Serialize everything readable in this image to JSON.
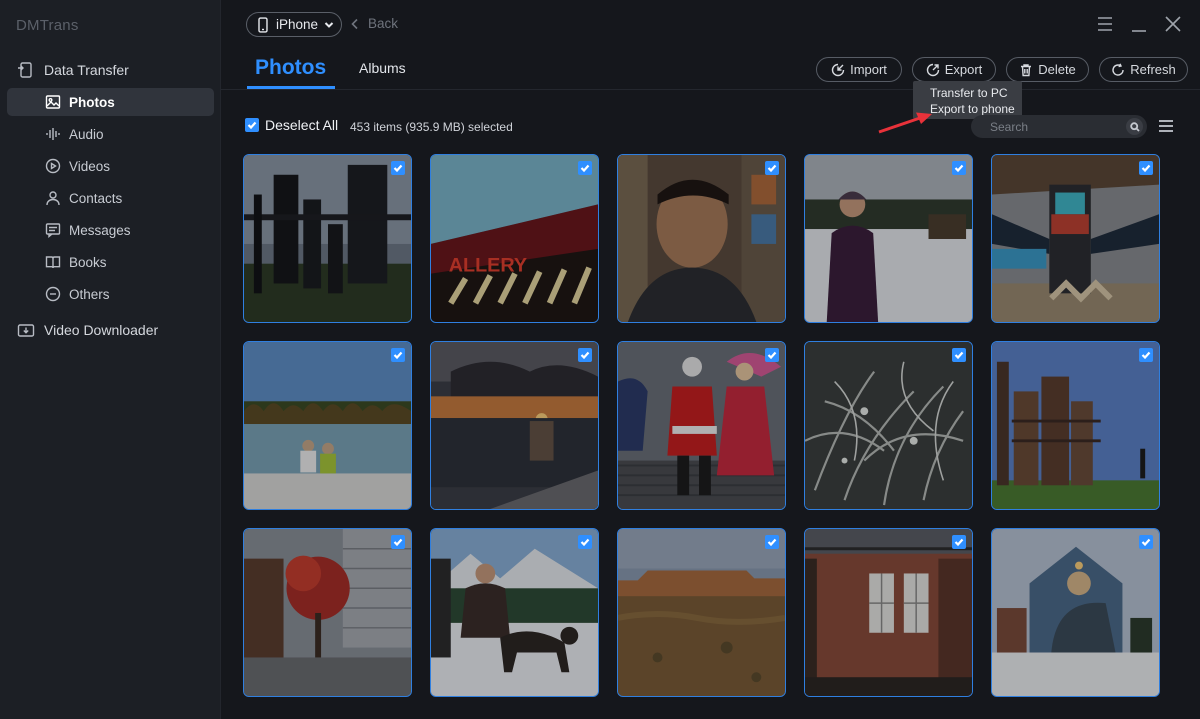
{
  "app": {
    "name": "DMTrans"
  },
  "sidebar": {
    "data_transfer": "Data Transfer",
    "items": [
      {
        "label": "Photos",
        "icon": "photos-icon",
        "active": true
      },
      {
        "label": "Audio",
        "icon": "audio-icon"
      },
      {
        "label": "Videos",
        "icon": "videos-icon"
      },
      {
        "label": "Contacts",
        "icon": "contacts-icon"
      },
      {
        "label": "Messages",
        "icon": "messages-icon"
      },
      {
        "label": "Books",
        "icon": "books-icon"
      },
      {
        "label": "Others",
        "icon": "others-icon"
      }
    ],
    "video_downloader": "Video Downloader"
  },
  "topbar": {
    "device": "iPhone",
    "back": "Back"
  },
  "tabs": {
    "photos": "Photos",
    "albums": "Albums"
  },
  "toolbar": {
    "import": "Import",
    "export": "Export",
    "delete": "Delete",
    "refresh": "Refresh"
  },
  "export_menu": {
    "transfer_to_pc": "Transfer to PC",
    "export_to_phone": "Export to phone"
  },
  "selection": {
    "deselect_all": "Deselect All",
    "info": "453 items (935.9 MB) selected"
  },
  "search": {
    "placeholder": "Search"
  },
  "colors": {
    "accent": "#2f8fff",
    "arrow": "#e8323a",
    "background": "#15171c",
    "sidebar": "#1c1f25"
  },
  "photos": [
    {
      "subject": "industrial-silhouette",
      "selected": true
    },
    {
      "subject": "gallery-sign",
      "selected": true
    },
    {
      "subject": "man-portrait",
      "selected": true
    },
    {
      "subject": "woman-snow",
      "selected": true
    },
    {
      "subject": "totem-pole",
      "selected": true
    },
    {
      "subject": "couple-lake",
      "selected": true
    },
    {
      "subject": "sunset-sea",
      "selected": true
    },
    {
      "subject": "santa-costumes",
      "selected": true
    },
    {
      "subject": "frosted-plants",
      "selected": true
    },
    {
      "subject": "gas-works",
      "selected": true
    },
    {
      "subject": "autumn-tree-street",
      "selected": true
    },
    {
      "subject": "dog-snow",
      "selected": true
    },
    {
      "subject": "desert-mesa",
      "selected": true
    },
    {
      "subject": "brick-building",
      "selected": true
    },
    {
      "subject": "mural-house",
      "selected": true
    }
  ]
}
